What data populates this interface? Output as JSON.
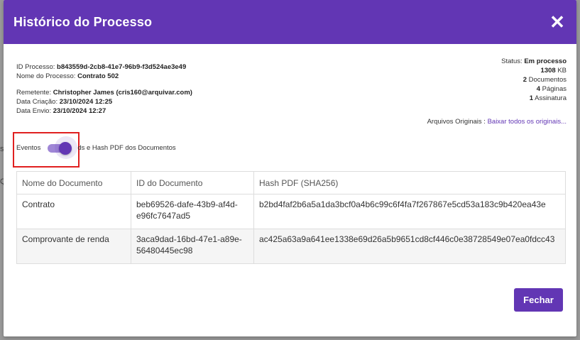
{
  "backdrop": {
    "fragment_1": "s)",
    "fragment_2": "Q"
  },
  "modal": {
    "title": "Histórico do Processo",
    "close_icon": "close-icon",
    "close_glyph": "✕"
  },
  "process": {
    "id_label": "ID Processo:",
    "id_value": "b843559d-2cb8-41e7-96b9-f3d524ae3e49",
    "name_label": "Nome do Processo:",
    "name_value": "Contrato 502",
    "sender_label": "Remetente:",
    "sender_value": "Christopher James (cris160@arquivar.com)",
    "created_label": "Data Criação:",
    "created_value": "23/10/2024 12:25",
    "sent_label": "Data Envio:",
    "sent_value": "23/10/2024 12:27"
  },
  "summary": {
    "status_label": "Status:",
    "status_value": "Em processo",
    "size_value": "1308",
    "size_unit": "KB",
    "documents_count": "2",
    "documents_label": "Documentos",
    "pages_count": "4",
    "pages_label": "Páginas",
    "signatures_count": "1",
    "signatures_label": "Assinatura"
  },
  "originals": {
    "label": "Arquivos Originais :",
    "link": "Baixar todos os originais..."
  },
  "toggle": {
    "label": "Eventos",
    "caption": "ds e Hash PDF dos Documentos",
    "checked": true,
    "accent": "#6236b4"
  },
  "table": {
    "headers": [
      "Nome do Documento",
      "ID do Documento",
      "Hash PDF (SHA256)"
    ],
    "rows": [
      {
        "name": "Contrato",
        "id": "beb69526-dafe-43b9-af4d-e96fc7647ad5",
        "hash": "b2bd4faf2b6a5a1da3bcf0a4b6c99c6f4fa7f267867e5cd53a183c9b420ea43e"
      },
      {
        "name": "Comprovante de renda",
        "id": "3aca9dad-16bd-47e1-a89e-56480445ec98",
        "hash": "ac425a63a9a641ee1338e69d26a5b9651cd8cf446c0e38728549e07ea0fdcc43"
      }
    ]
  },
  "footer": {
    "close_label": "Fechar"
  },
  "colors": {
    "primary": "#6236b4",
    "highlight": "#e02020"
  }
}
